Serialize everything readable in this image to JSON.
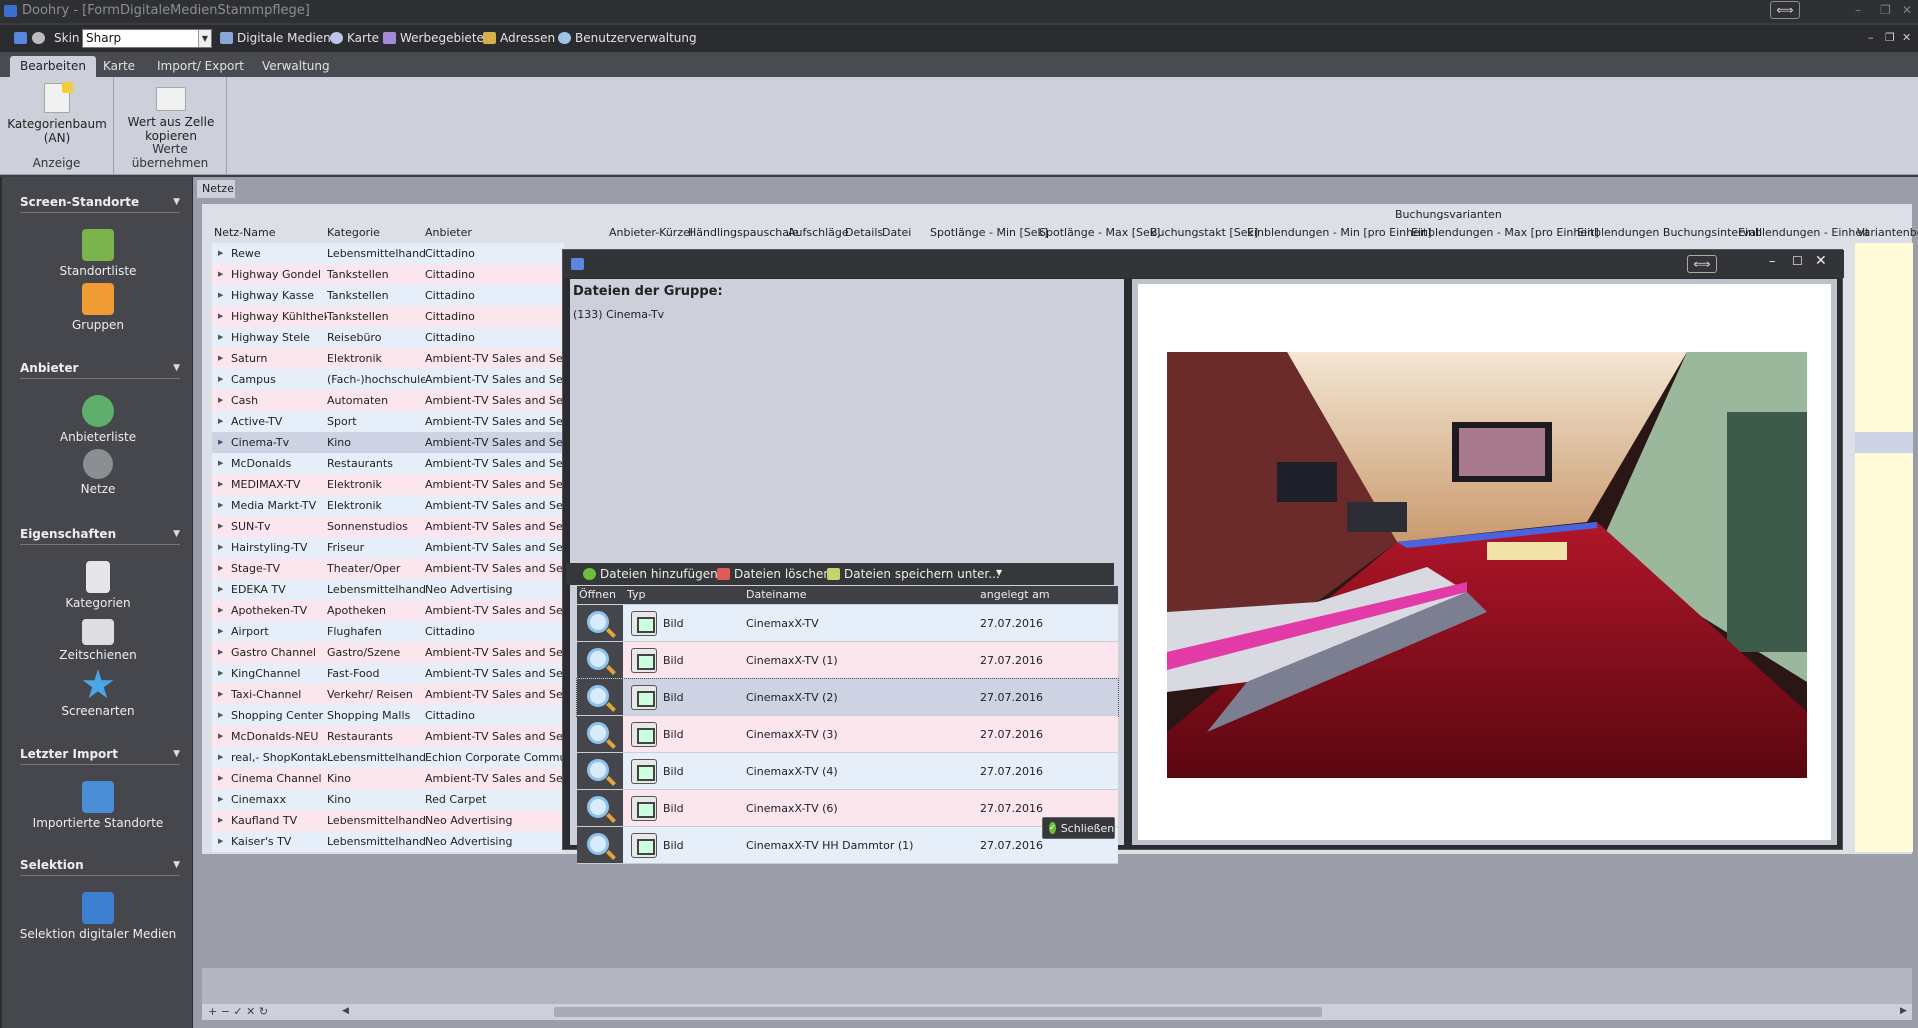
{
  "app": {
    "title": "Doohry - [FormDigitaleMedienStammpflege]"
  },
  "menubar": {
    "skin_label": "Skin",
    "skin_value": "Sharp",
    "items": [
      "Digitale Medien",
      "Karte",
      "Werbegebiete",
      "Adressen",
      "Benutzerverwaltung"
    ]
  },
  "ribbon_tabs": [
    "Bearbeiten",
    "Karte",
    "Import/ Export",
    "Verwaltung"
  ],
  "ribbon": {
    "group1": {
      "button_line1": "Kategorienbaum",
      "button_line2": "(AN)",
      "label": "Anzeige"
    },
    "group2": {
      "button_line1": "Wert aus Zelle",
      "button_line2": "kopieren",
      "label": "Werte übernehmen"
    }
  },
  "sidebar": {
    "sections": [
      {
        "title": "Screen-Standorte",
        "items": [
          "Standortliste",
          "Gruppen"
        ]
      },
      {
        "title": "Anbieter",
        "items": [
          "Anbieterliste",
          "Netze"
        ]
      },
      {
        "title": "Eigenschaften",
        "items": [
          "Kategorien",
          "Zeitschienen",
          "Screenarten"
        ]
      },
      {
        "title": "Letzter Import",
        "items": [
          "Importierte Standorte"
        ]
      },
      {
        "title": "Selektion",
        "items": [
          "Selektion digitaler Medien"
        ]
      }
    ]
  },
  "grid": {
    "tab": "Netze",
    "band_header": "Buchungsvarianten",
    "columns": [
      "Netz-Name",
      "Kategorie",
      "Anbieter",
      "Anbieter-Kürzel",
      "Händlingspauschale",
      "Aufschläge",
      "Details",
      "Datei",
      "Spotlänge - Min [Sek]",
      "Spotlänge - Max [Sek]",
      "Buchungstakt [Sek]",
      "Einblendungen - Min [pro Einheit]",
      "Einblendungen - Max [pro Einheit]",
      "Einblendungen Buchungsintervall",
      "Einblendungen - Einheit",
      "Variantenbe"
    ],
    "rows": [
      [
        "Rewe",
        "Lebensmittelhandel",
        "Cittadino"
      ],
      [
        "Highway Gondel",
        "Tankstellen",
        "Cittadino"
      ],
      [
        "Highway Kasse",
        "Tankstellen",
        "Cittadino"
      ],
      [
        "Highway Kühltheke",
        "Tankstellen",
        "Cittadino"
      ],
      [
        "Highway Stele",
        "Reisebüro",
        "Cittadino"
      ],
      [
        "Saturn",
        "Elektronik",
        "Ambient-TV Sales and Servic"
      ],
      [
        "Campus",
        "(Fach-)hochschule",
        "Ambient-TV Sales and Servic"
      ],
      [
        "Cash",
        "Automaten",
        "Ambient-TV Sales and Servic"
      ],
      [
        "Active-TV",
        "Sport",
        "Ambient-TV Sales and Servic"
      ],
      [
        "Cinema-Tv",
        "Kino",
        "Ambient-TV Sales and Servic"
      ],
      [
        "McDonalds",
        "Restaurants",
        "Ambient-TV Sales and Servic"
      ],
      [
        "MEDIMAX-TV",
        "Elektronik",
        "Ambient-TV Sales and Servic"
      ],
      [
        "Media Markt-TV",
        "Elektronik",
        "Ambient-TV Sales and Servic"
      ],
      [
        "SUN-Tv",
        "Sonnenstudios",
        "Ambient-TV Sales and Servic"
      ],
      [
        "Hairstyling-TV",
        "Friseur",
        "Ambient-TV Sales and Servic"
      ],
      [
        "Stage-TV",
        "Theater/Oper",
        "Ambient-TV Sales and Servic"
      ],
      [
        "EDEKA TV",
        "Lebensmittelhandel",
        "Neo Advertising"
      ],
      [
        "Apotheken-TV",
        "Apotheken",
        "Ambient-TV Sales and Servic"
      ],
      [
        "Airport",
        "Flughafen",
        "Cittadino"
      ],
      [
        "Gastro Channel",
        "Gastro/Szene",
        "Ambient-TV Sales and Servic"
      ],
      [
        "KingChannel",
        "Fast-Food",
        "Ambient-TV Sales and Servic"
      ],
      [
        "Taxi-Channel",
        "Verkehr/ Reisen",
        "Ambient-TV Sales and Servic"
      ],
      [
        "Shopping Center",
        "Shopping Malls",
        "Cittadino"
      ],
      [
        "McDonalds-NEU",
        "Restaurants",
        "Ambient-TV Sales and Servic"
      ],
      [
        "real,- ShopKontakt",
        "Lebensmittelhandel",
        "Echion Corporate Communica"
      ],
      [
        "Cinema Channel",
        "Kino",
        "Ambient-TV Sales and Servic"
      ],
      [
        "Cinemaxx",
        "Kino",
        "Red Carpet"
      ],
      [
        "Kaufland TV",
        "Lebensmittelhandel",
        "Neo Advertising"
      ],
      [
        "Kaiser's TV",
        "Lebensmittelhandel",
        "Neo Advertising"
      ]
    ]
  },
  "dialog": {
    "heading": "Dateien der Gruppe:",
    "group": "(133) Cinema-Tv",
    "toolbar": [
      "Dateien hinzufügen",
      "Dateien löschen",
      "Dateien speichern unter..."
    ],
    "columns": [
      "Öffnen",
      "Typ",
      "Dateiname",
      "angelegt am"
    ],
    "files": [
      {
        "type": "Bild",
        "name": "CinemaxX-TV",
        "date": "27.07.2016"
      },
      {
        "type": "Bild",
        "name": "CinemaxX-TV (1)",
        "date": "27.07.2016"
      },
      {
        "type": "Bild",
        "name": "CinemaxX-TV (2)",
        "date": "27.07.2016"
      },
      {
        "type": "Bild",
        "name": "CinemaxX-TV (3)",
        "date": "27.07.2016"
      },
      {
        "type": "Bild",
        "name": "CinemaxX-TV (4)",
        "date": "27.07.2016"
      },
      {
        "type": "Bild",
        "name": "CinemaxX-TV (6)",
        "date": "27.07.2016"
      },
      {
        "type": "Bild",
        "name": "CinemaxX-TV HH Dammtor (1)",
        "date": "27.07.2016"
      }
    ],
    "close_label": "Schließen"
  },
  "colors": {
    "accent": "#3a6fcf",
    "row_blue": "#e6eefa",
    "row_pink": "#fbe6ee",
    "row_selected": "#cdd3e3",
    "side_yellow": "#fffbd9"
  }
}
